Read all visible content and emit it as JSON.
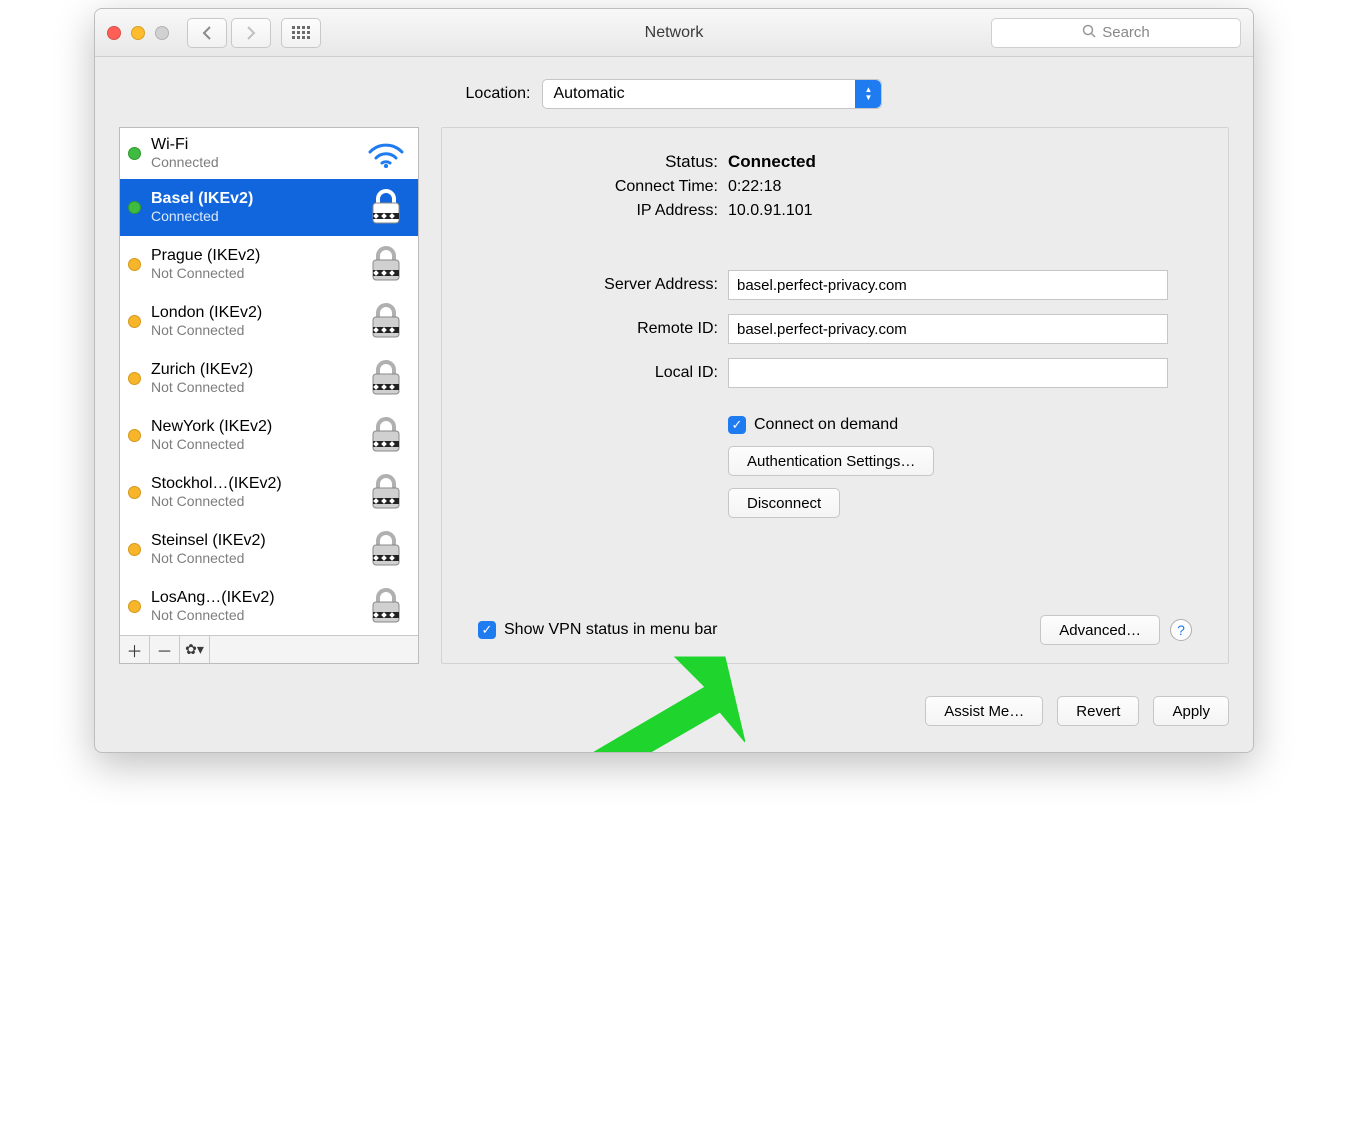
{
  "window": {
    "title": "Network",
    "search_placeholder": "Search"
  },
  "location": {
    "label": "Location:",
    "selected": "Automatic"
  },
  "sidebar": {
    "services": [
      {
        "name": "Wi-Fi",
        "state": "Connected",
        "status": "green",
        "icon": "wifi"
      },
      {
        "name": "Basel (IKEv2)",
        "state": "Connected",
        "status": "green",
        "icon": "lock",
        "selected": true
      },
      {
        "name": "Prague (IKEv2)",
        "state": "Not Connected",
        "status": "amber",
        "icon": "lock"
      },
      {
        "name": "London (IKEv2)",
        "state": "Not Connected",
        "status": "amber",
        "icon": "lock"
      },
      {
        "name": "Zurich (IKEv2)",
        "state": "Not Connected",
        "status": "amber",
        "icon": "lock"
      },
      {
        "name": "NewYork (IKEv2)",
        "state": "Not Connected",
        "status": "amber",
        "icon": "lock"
      },
      {
        "name": "Stockhol…(IKEv2)",
        "state": "Not Connected",
        "status": "amber",
        "icon": "lock"
      },
      {
        "name": "Steinsel (IKEv2)",
        "state": "Not Connected",
        "status": "amber",
        "icon": "lock"
      },
      {
        "name": "LosAng…(IKEv2)",
        "state": "Not Connected",
        "status": "amber",
        "icon": "lock"
      }
    ]
  },
  "detail": {
    "status_label": "Status:",
    "status_value": "Connected",
    "connect_time_label": "Connect Time:",
    "connect_time_value": "0:22:18",
    "ip_label": "IP Address:",
    "ip_value": "10.0.91.101",
    "server_address_label": "Server Address:",
    "server_address_value": "basel.perfect-privacy.com",
    "remote_id_label": "Remote ID:",
    "remote_id_value": "basel.perfect-privacy.com",
    "local_id_label": "Local ID:",
    "local_id_value": "",
    "connect_on_demand_label": "Connect on demand",
    "connect_on_demand_checked": true,
    "auth_settings_label": "Authentication Settings…",
    "disconnect_label": "Disconnect",
    "show_vpn_label": "Show VPN status in menu bar",
    "show_vpn_checked": true,
    "advanced_label": "Advanced…"
  },
  "footer": {
    "assist_label": "Assist Me…",
    "revert_label": "Revert",
    "apply_label": "Apply"
  }
}
